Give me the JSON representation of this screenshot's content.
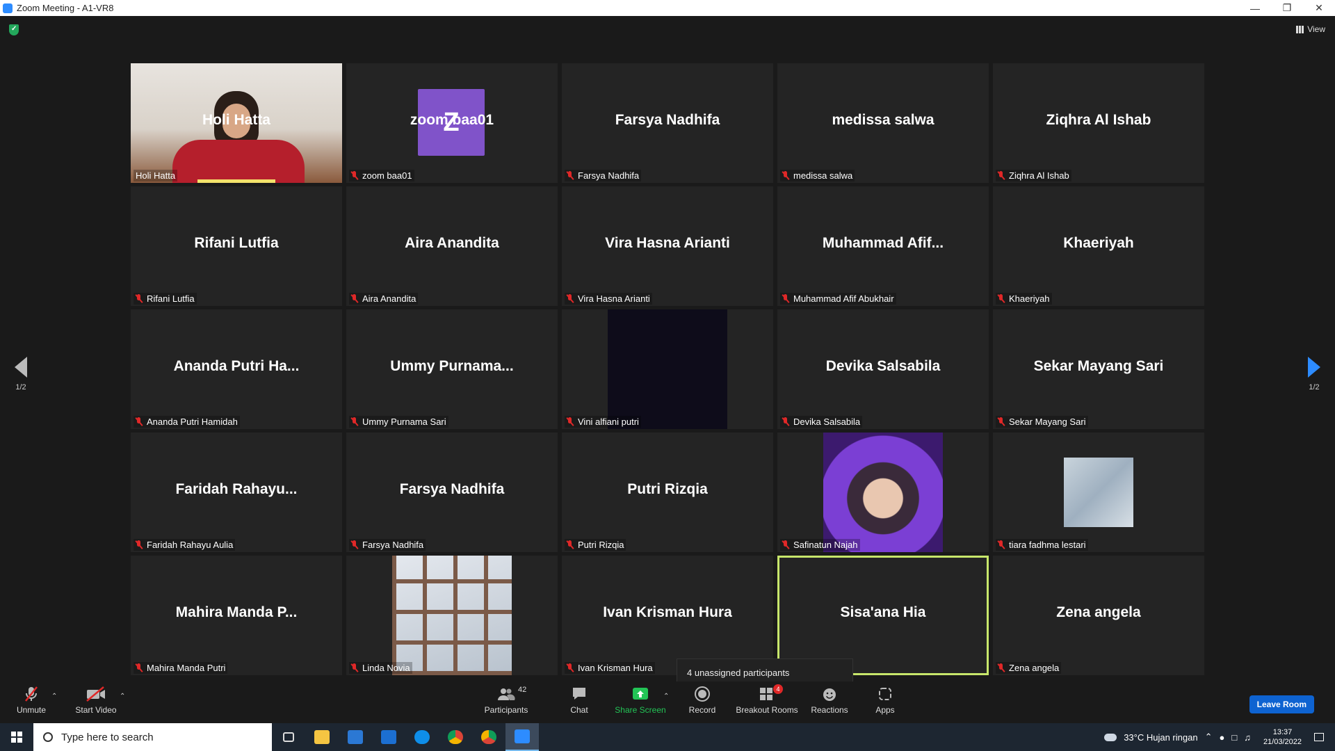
{
  "window": {
    "title": "Zoom Meeting - A1-VR8"
  },
  "top": {
    "view_label": "View"
  },
  "pager": {
    "left": "1/2",
    "right": "1/2"
  },
  "tiles": [
    {
      "name": "Holi Hatta",
      "label": "Holi Hatta",
      "type": "video"
    },
    {
      "name": "zoom baa01",
      "label": "zoom baa01",
      "type": "avatar",
      "initial": "Z",
      "color": "#8053c9"
    },
    {
      "name": "Farsya Nadhifa",
      "label": "Farsya Nadhifa",
      "type": "name"
    },
    {
      "name": "medissa salwa",
      "label": "medissa salwa",
      "type": "name"
    },
    {
      "name": "Ziqhra Al Ishab",
      "label": "Ziqhra Al Ishab",
      "type": "name"
    },
    {
      "name": "Rifani Lutfia",
      "label": "Rifani Lutfia",
      "type": "name"
    },
    {
      "name": "Aira Anandita",
      "label": "Aira Anandita",
      "type": "name"
    },
    {
      "name": "Vira Hasna Arianti",
      "label": "Vira Hasna Arianti",
      "type": "name"
    },
    {
      "name": "Muhammad  Afif...",
      "label": "Muhammad Afif Abukhair",
      "type": "name"
    },
    {
      "name": "Khaeriyah",
      "label": "Khaeriyah",
      "type": "name"
    },
    {
      "name": "Ananda Putri Ha...",
      "label": "Ananda Putri Hamidah",
      "type": "name"
    },
    {
      "name": "Ummy  Purnama...",
      "label": "Ummy Purnama Sari",
      "type": "name"
    },
    {
      "name": "",
      "label": "Vini alfiani putri",
      "type": "dark-photo"
    },
    {
      "name": "Devika Salsabila",
      "label": "Devika Salsabila",
      "type": "name"
    },
    {
      "name": "Sekar Mayang Sari",
      "label": "Sekar Mayang Sari",
      "type": "name"
    },
    {
      "name": "Faridah  Rahayu...",
      "label": "Faridah Rahayu Aulia",
      "type": "name"
    },
    {
      "name": "Farsya Nadhifa",
      "label": "Farsya Nadhifa",
      "type": "name"
    },
    {
      "name": "Putri Rizqia",
      "label": "Putri Rizqia",
      "type": "name"
    },
    {
      "name": "",
      "label": "Safinatun Najah",
      "type": "purple-photo"
    },
    {
      "name": "",
      "label": "tiara fadhma lestari",
      "type": "sky-photo"
    },
    {
      "name": "Mahira Manda P...",
      "label": "Mahira Manda Putri",
      "type": "name"
    },
    {
      "name": "",
      "label": "Linda Novia",
      "type": "window-photo"
    },
    {
      "name": "Ivan Krisman Hura",
      "label": "Ivan Krisman Hura",
      "type": "name"
    },
    {
      "name": "Sisa'ana Hia",
      "label": "",
      "type": "name",
      "speaking": true
    },
    {
      "name": "Zena angela",
      "label": "Zena angela",
      "type": "name"
    }
  ],
  "tooltip": "4 unassigned participants",
  "toolbar": {
    "unmute": "Unmute",
    "start_video": "Start Video",
    "participants": "Participants",
    "participants_count": "42",
    "chat": "Chat",
    "share_screen": "Share Screen",
    "record": "Record",
    "breakout_rooms": "Breakout Rooms",
    "breakout_badge": "4",
    "reactions": "Reactions",
    "apps": "Apps",
    "leave": "Leave Room"
  },
  "taskbar": {
    "search_placeholder": "Type here to search",
    "weather": "33°C  Hujan ringan",
    "time": "13:37",
    "date": "21/03/2022"
  },
  "colors": {
    "accent": "#2d8cff",
    "share_green": "#23c456",
    "speaker": "#c7e66b",
    "mute_red": "#e02828"
  }
}
